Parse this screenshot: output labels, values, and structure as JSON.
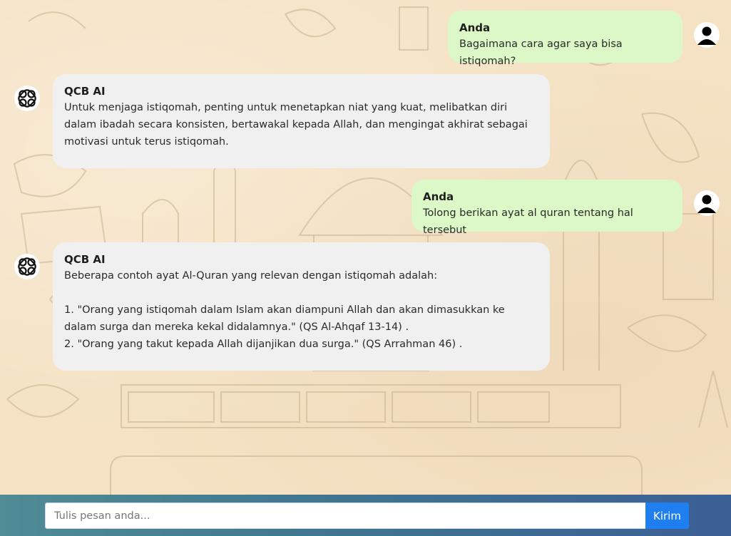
{
  "messages": [
    {
      "role": "user",
      "sender": "Anda",
      "text": "Bagaimana cara agar saya bisa istiqomah?"
    },
    {
      "role": "bot",
      "sender": "QCB AI",
      "text": "Untuk menjaga istiqomah, penting untuk menetapkan niat yang kuat, melibatkan diri dalam ibadah secara konsisten, bertawakal kepada Allah, dan mengingat akhirat sebagai motivasi untuk terus istiqomah."
    },
    {
      "role": "user",
      "sender": "Anda",
      "text": "Tolong berikan ayat al quran tentang hal tersebut"
    },
    {
      "role": "bot",
      "sender": "QCB AI",
      "text": "Beberapa contoh ayat Al-Quran yang relevan dengan istiqomah adalah:\n\n1. \"Orang yang istiqomah dalam Islam akan diampuni Allah dan akan dimasukkan ke dalam surga dan mereka kekal didalamnya.\" (QS Al-Ahqaf 13-14) .\n2. \"Orang yang takut kepada Allah dijanjikan dua surga.\" (QS Arrahman 46) ."
    }
  ],
  "composer": {
    "placeholder": "Tulis pesan anda...",
    "send_label": "Kirim"
  },
  "icons": {
    "user_avatar": "user-silhouette-icon",
    "bot_avatar": "knot-logo-icon"
  },
  "colors": {
    "user_bubble": "#dcf8c6",
    "bot_bubble": "#f1f0f0",
    "send_button": "#1f7ef0"
  }
}
